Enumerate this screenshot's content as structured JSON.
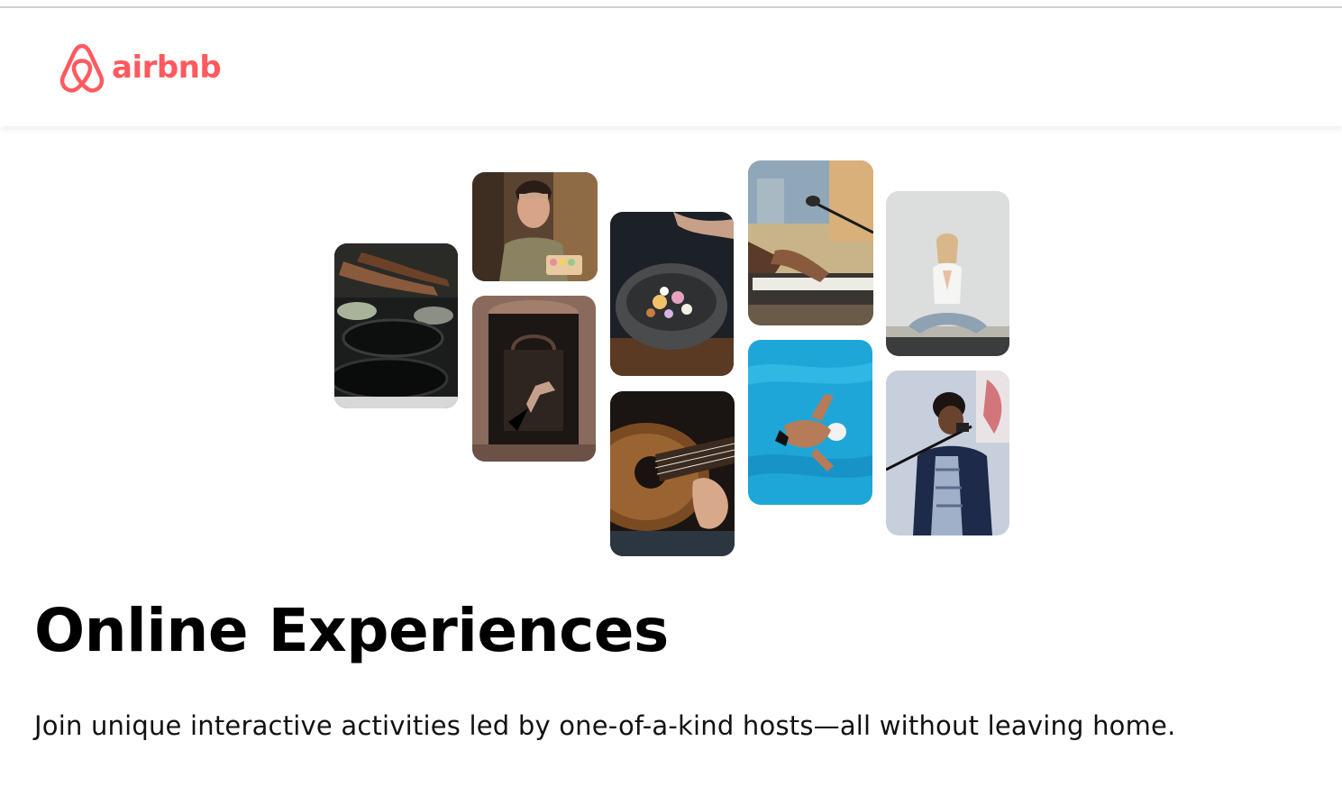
{
  "brand": {
    "name": "airbnb",
    "color": "#ff5a5f"
  },
  "hero": {
    "title": "Online Experiences",
    "subtitle": "Join unique interactive activities led by one-of-a-kind hosts—all without leaving home."
  },
  "collage": {
    "tiles": [
      {
        "subject": "cooking-pans-photo"
      },
      {
        "subject": "baker-woman-macarons-photo"
      },
      {
        "subject": "flamenco-dancer-archway-photo"
      },
      {
        "subject": "food-bowl-seasoning-photo"
      },
      {
        "subject": "acoustic-guitar-photo"
      },
      {
        "subject": "piano-microphone-photo"
      },
      {
        "subject": "swimmer-pool-photo"
      },
      {
        "subject": "yoga-meditation-photo"
      },
      {
        "subject": "singer-microphone-photo"
      }
    ]
  }
}
